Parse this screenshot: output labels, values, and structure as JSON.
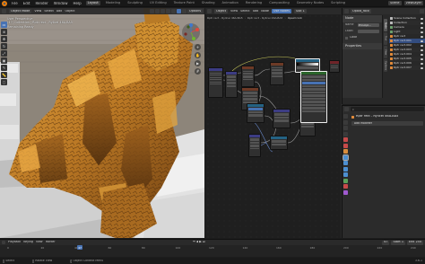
{
  "topbar": {
    "menus": [
      "File",
      "Edit",
      "Render",
      "Window",
      "Help"
    ],
    "workspaces": [
      "Layout",
      "Modeling",
      "Sculpting",
      "UV Editing",
      "Texture Paint",
      "Shading",
      "Animation",
      "Rendering",
      "Compositing",
      "Geometry Nodes",
      "Scripting"
    ],
    "active_workspace": "Layout",
    "scene_name": "Scene",
    "view_layer": "ViewLayer"
  },
  "viewport": {
    "mode": "Object Mode",
    "menus": [
      "View",
      "Select",
      "Add",
      "Object"
    ],
    "options_label": "Options",
    "info_lines": [
      "User Perspective",
      "(47) Collection | Rptr rect - Ryllcei 46A-BA5",
      "Remaining Ready"
    ],
    "colors": {
      "rock": "#c88a2c",
      "floor": "#bdbdbd",
      "blocks": "#dedede",
      "building": "#8f8578"
    }
  },
  "node_editor": {
    "type_icon": "node-editor-icon",
    "menus": [
      "View",
      "Select",
      "Add",
      "Node"
    ],
    "use_nodes_label": "Use Nodes",
    "slot_label": "Slot 1",
    "material_name": "Opaid_rock",
    "breadcrumb": [
      "Rptr rect - Ryllcei 46A-BA5",
      "Rptr rect - Ryllcei 46A-BA5",
      "Opaid rock"
    ],
    "node_panel": {
      "title": "Node",
      "name_label": "Name",
      "name_value": "Principl...",
      "label_label": "Label",
      "color_label": "Color",
      "properties_label": "Properties"
    },
    "side_tabs": [
      "Node",
      "Tool",
      "View",
      "Options"
    ],
    "active_side_tab": "Node"
  },
  "outliner": {
    "items": [
      {
        "name": "Scene Collection",
        "kind": "w"
      },
      {
        "name": "Collection",
        "kind": "w"
      },
      {
        "name": "Camera",
        "kind": "g"
      },
      {
        "name": "Light",
        "kind": "g"
      },
      {
        "name": "Rptr rect",
        "kind": "o"
      },
      {
        "name": "Rptr rect.001",
        "kind": "o"
      },
      {
        "name": "Rptr rect.002",
        "kind": "o"
      },
      {
        "name": "Rptr rect.003",
        "kind": "o"
      },
      {
        "name": "Rptr rect.004",
        "kind": "o"
      },
      {
        "name": "Rptr rect.005",
        "kind": "o"
      },
      {
        "name": "Rptr rect.006",
        "kind": "o"
      },
      {
        "name": "Rptr rect.007",
        "kind": "o"
      }
    ],
    "selected_index": 5
  },
  "properties": {
    "object_name": "Rptr rect - Ryllcei 46A-BA5",
    "section": "Modifiers",
    "add_modifier_label": "Add Modifier"
  },
  "timeline": {
    "menus": [
      "Playback",
      "Keying",
      "View",
      "Marker"
    ],
    "current_frame": "47",
    "start_label": "Start",
    "start_value": "1",
    "end_label": "End",
    "end_value": "250",
    "ticks": [
      "0",
      "20",
      "40",
      "60",
      "80",
      "100",
      "120",
      "140",
      "160",
      "180",
      "200",
      "220",
      "240"
    ]
  },
  "statusbar": {
    "items": [
      "Select",
      "Rotate View",
      "Object Context Menu"
    ],
    "version": "3.6.1"
  }
}
